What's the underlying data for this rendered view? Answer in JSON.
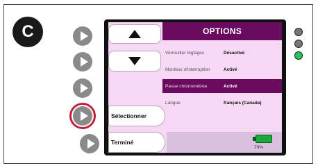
{
  "step": {
    "badge": "C"
  },
  "screen": {
    "title": "OPTIONS",
    "softkeys": {
      "up_icon": "arrow-up-icon",
      "down_icon": "arrow-down-icon",
      "select_label": "Sélectionner",
      "done_label": "Terminé"
    },
    "menu": [
      {
        "label": "Verrouiller réglages",
        "value": "Désactivé",
        "selected": false
      },
      {
        "label": "Moniteur d'interruption",
        "value": "Activé",
        "selected": false
      },
      {
        "label": "Pause chronométrée",
        "value": "Activé",
        "selected": true
      },
      {
        "label": "Langue",
        "value": "français (Canada)",
        "selected": false
      }
    ],
    "battery": {
      "percent_label": "70%",
      "level": 0.7
    }
  },
  "indicators": [
    {
      "name": "led-gray-1",
      "color": "#777777"
    },
    {
      "name": "led-gray-2",
      "color": "#777777"
    },
    {
      "name": "led-green",
      "color": "#22c55e"
    }
  ],
  "colors": {
    "accent": "#6a0a5e",
    "screen_bg": "#f7d8f4",
    "highlight_ring": "#c0203a"
  }
}
